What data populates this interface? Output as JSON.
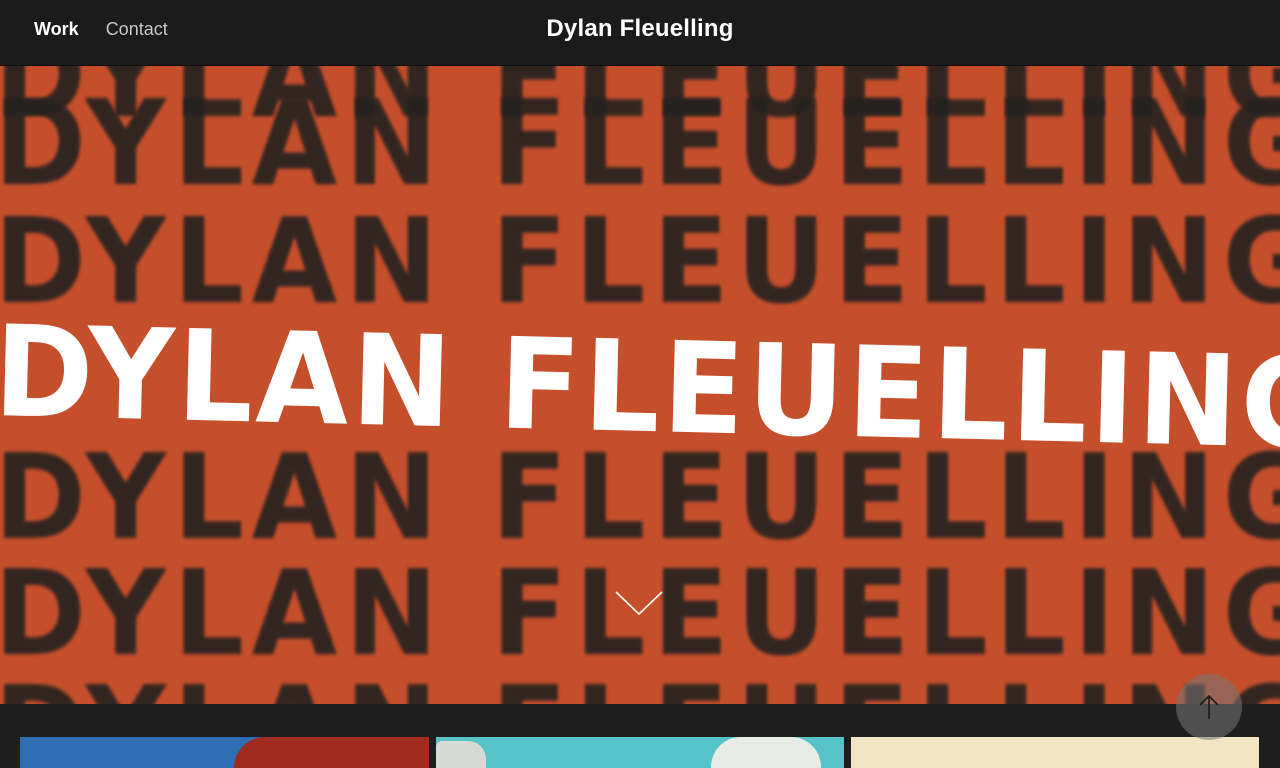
{
  "nav": {
    "items": [
      {
        "label": "Work",
        "active": true
      },
      {
        "label": "Contact",
        "active": false
      }
    ]
  },
  "header": {
    "title": "Dylan Fleuelling"
  },
  "hero": {
    "background_color": "#c64f2b",
    "repeated_text": "DYLAN FLEUELLING",
    "headline": "DYLAN FLEUELLING",
    "scroll_down_icon": "chevron-down-icon"
  },
  "scroll_top": {
    "icon": "arrow-up-icon"
  },
  "thumbnails": [
    {
      "colors": [
        "#2e6fb3",
        "#a22b1f"
      ]
    },
    {
      "colors": [
        "#55c3c7",
        "#e8ece6"
      ]
    },
    {
      "colors": [
        "#f3e4c6"
      ]
    }
  ]
}
